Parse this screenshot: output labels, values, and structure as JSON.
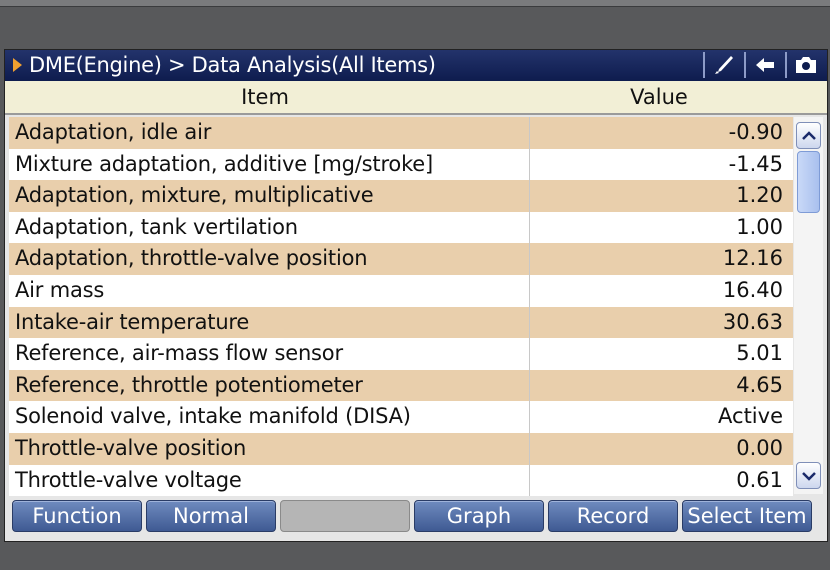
{
  "titlebar": {
    "title": "DME(Engine) > Data Analysis(All Items)",
    "icons": [
      "pen-icon",
      "back-arrow-icon",
      "camera-icon"
    ]
  },
  "table": {
    "headers": {
      "item": "Item",
      "value": "Value"
    },
    "rows": [
      {
        "item": "Adaptation, idle air",
        "value": "-0.90"
      },
      {
        "item": "Mixture adaptation, additive [mg/stroke]",
        "value": "-1.45"
      },
      {
        "item": "Adaptation, mixture, multiplicative",
        "value": "1.20"
      },
      {
        "item": "Adaptation, tank vertilation",
        "value": "1.00"
      },
      {
        "item": "Adaptation, throttle-valve position",
        "value": "12.16"
      },
      {
        "item": "Air mass",
        "value": "16.40"
      },
      {
        "item": "Intake-air temperature",
        "value": "30.63"
      },
      {
        "item": "Reference, air-mass flow sensor",
        "value": "5.01"
      },
      {
        "item": "Reference, throttle potentiometer",
        "value": "4.65"
      },
      {
        "item": "Solenoid valve, intake manifold (DISA)",
        "value": "Active"
      },
      {
        "item": "Throttle-valve position",
        "value": "0.00"
      },
      {
        "item": "Throttle-valve voltage",
        "value": "0.61"
      }
    ]
  },
  "buttons": {
    "function": "Function",
    "normal": "Normal",
    "blank": "",
    "graph": "Graph",
    "record": "Record",
    "select_item": "Select Item"
  },
  "colors": {
    "titlebar": "#0e1c4e",
    "row_alt": "#e9cfac",
    "button": "#4f6ba3",
    "accent_arrow": "#f0a030"
  }
}
